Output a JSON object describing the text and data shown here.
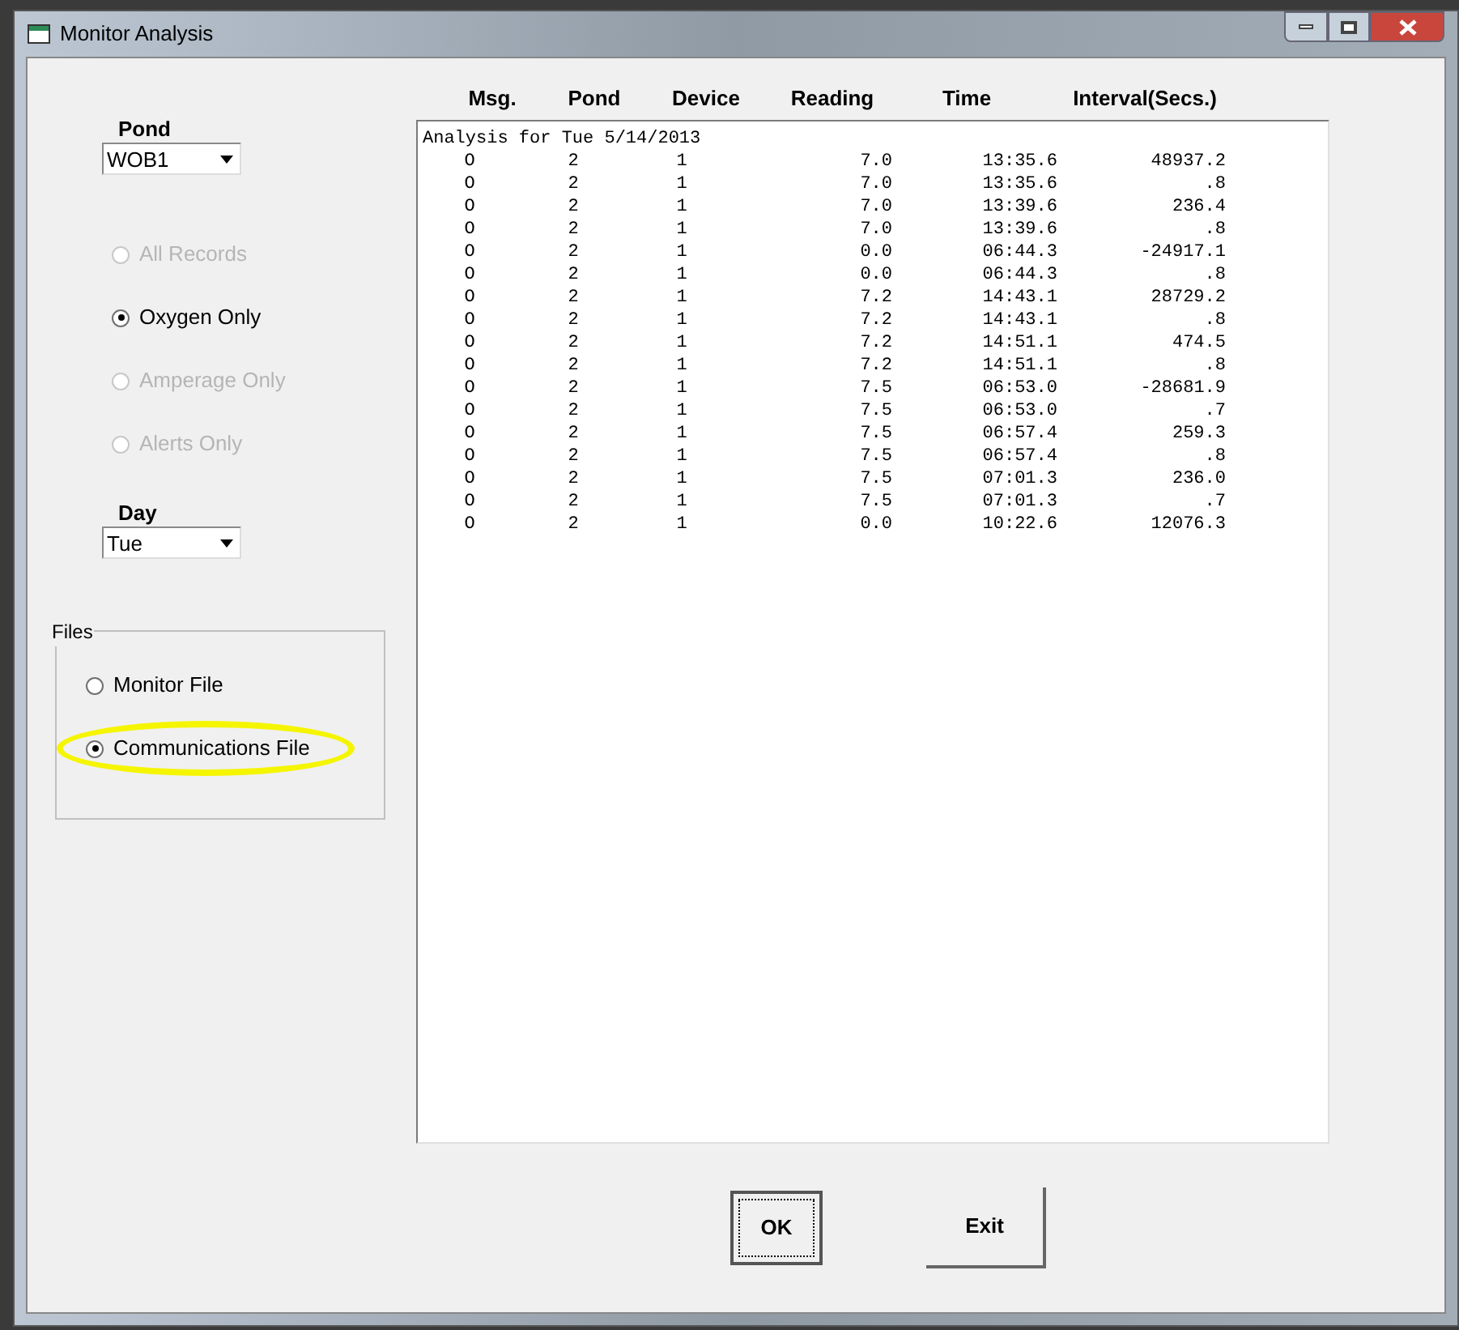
{
  "window": {
    "title": "Monitor Analysis"
  },
  "pond": {
    "label": "Pond",
    "value": "WOB1"
  },
  "record_filter": [
    {
      "label": "All Records",
      "selected": false,
      "disabled": true
    },
    {
      "label": "Oxygen Only",
      "selected": true,
      "disabled": false
    },
    {
      "label": "Amperage Only",
      "selected": false,
      "disabled": true
    },
    {
      "label": "Alerts Only",
      "selected": false,
      "disabled": true
    }
  ],
  "day": {
    "label": "Day",
    "value": "Tue"
  },
  "files": {
    "title": "Files",
    "options": [
      {
        "label": "Monitor File",
        "selected": false,
        "highlighted": false
      },
      {
        "label": "Communications File",
        "selected": true,
        "highlighted": true
      }
    ]
  },
  "table": {
    "columns": [
      "Msg.",
      "Pond",
      "Device",
      "Reading",
      "Time",
      "Interval(Secs.)"
    ],
    "caption": "Analysis for Tue 5/14/2013",
    "rows": [
      [
        "O",
        "2",
        "1",
        "7.0",
        "13:35.6",
        "48937.2"
      ],
      [
        "O",
        "2",
        "1",
        "7.0",
        "13:35.6",
        ".8"
      ],
      [
        "O",
        "2",
        "1",
        "7.0",
        "13:39.6",
        "236.4"
      ],
      [
        "O",
        "2",
        "1",
        "7.0",
        "13:39.6",
        ".8"
      ],
      [
        "O",
        "2",
        "1",
        "0.0",
        "06:44.3",
        "-24917.1"
      ],
      [
        "O",
        "2",
        "1",
        "0.0",
        "06:44.3",
        ".8"
      ],
      [
        "O",
        "2",
        "1",
        "7.2",
        "14:43.1",
        "28729.2"
      ],
      [
        "O",
        "2",
        "1",
        "7.2",
        "14:43.1",
        ".8"
      ],
      [
        "O",
        "2",
        "1",
        "7.2",
        "14:51.1",
        "474.5"
      ],
      [
        "O",
        "2",
        "1",
        "7.2",
        "14:51.1",
        ".8"
      ],
      [
        "O",
        "2",
        "1",
        "7.5",
        "06:53.0",
        "-28681.9"
      ],
      [
        "O",
        "2",
        "1",
        "7.5",
        "06:53.0",
        ".7"
      ],
      [
        "O",
        "2",
        "1",
        "7.5",
        "06:57.4",
        "259.3"
      ],
      [
        "O",
        "2",
        "1",
        "7.5",
        "06:57.4",
        ".8"
      ],
      [
        "O",
        "2",
        "1",
        "7.5",
        "07:01.3",
        "236.0"
      ],
      [
        "O",
        "2",
        "1",
        "7.5",
        "07:01.3",
        ".7"
      ],
      [
        "O",
        "2",
        "1",
        "0.0",
        "10:22.6",
        "12076.3"
      ]
    ]
  },
  "buttons": [
    {
      "label": "OK",
      "focused": true
    },
    {
      "label": "Exit",
      "focused": false
    }
  ]
}
